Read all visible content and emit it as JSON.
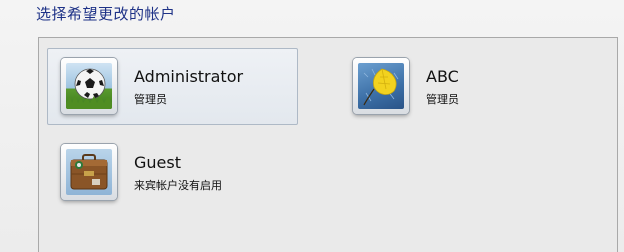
{
  "page": {
    "title": "选择希望更改的帐户"
  },
  "accounts": [
    {
      "name": "Administrator",
      "type": "管理员",
      "avatar_icon": "football-icon",
      "selected": true
    },
    {
      "name": "ABC",
      "type": "管理员",
      "avatar_icon": "yellow-leaf-icon",
      "selected": false
    },
    {
      "name": "Guest",
      "type": "来宾帐户没有启用",
      "avatar_icon": "suitcase-icon",
      "selected": false
    }
  ],
  "colors": {
    "title": "#1e3287",
    "selected_tile_border": "#aeb9c6",
    "panel_border": "#a9a9a9"
  }
}
